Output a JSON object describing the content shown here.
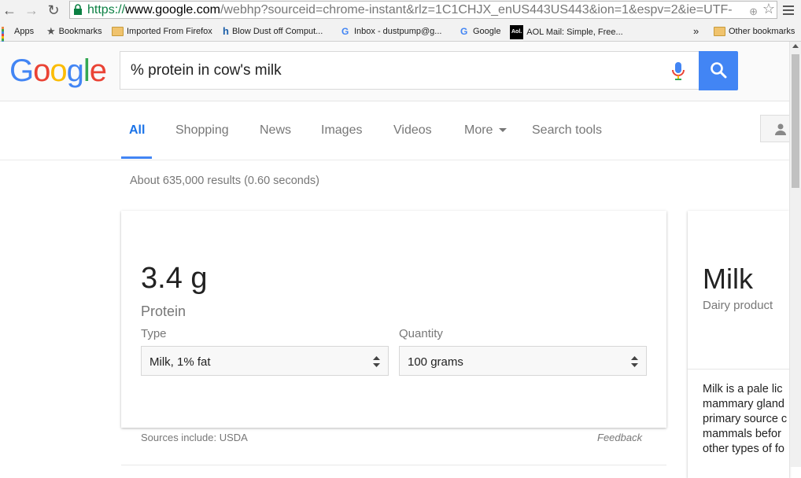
{
  "browser": {
    "url_scheme": "https://",
    "url_host": "www.google.com",
    "url_path": "/webhp?sourceid=chrome-instant&rlz=1C1CHJX_enUS443US443&ion=1&espv=2&ie=UTF-",
    "back_glyph": "←",
    "forward_glyph": "→",
    "reload_glyph": "↻",
    "star_glyph": "☆",
    "zoom_glyph": "⊕"
  },
  "bookmarks": {
    "items": [
      {
        "label": "Apps"
      },
      {
        "label": "Bookmarks"
      },
      {
        "label": "Imported From Firefox"
      },
      {
        "label": "Blow Dust off Comput..."
      },
      {
        "label": "Inbox - dustpump@g..."
      },
      {
        "label": "Google"
      },
      {
        "label": "AOL Mail: Simple, Free..."
      }
    ],
    "overflow": "»",
    "other": "Other bookmarks",
    "aol_badge": "Aol."
  },
  "google": {
    "logo": [
      "G",
      "o",
      "o",
      "g",
      "l",
      "e"
    ],
    "logo_colors": [
      "#4285f4",
      "#ea4335",
      "#fbbc05",
      "#4285f4",
      "#34a853",
      "#ea4335"
    ],
    "query": "% protein in cow's milk",
    "accent": "#4285f4"
  },
  "tabs": [
    {
      "label": "All"
    },
    {
      "label": "Shopping"
    },
    {
      "label": "News"
    },
    {
      "label": "Images"
    },
    {
      "label": "Videos"
    },
    {
      "label": "More"
    },
    {
      "label": "Search tools"
    }
  ],
  "results": {
    "stats": "About 635,000 results (0.60 seconds)"
  },
  "nutrition_card": {
    "amount": "3.4 g",
    "nutrient": "Protein",
    "type_label": "Type",
    "type_value": "Milk, 1% fat",
    "quantity_label": "Quantity",
    "quantity_value": "100 grams",
    "sources": "Sources include: USDA",
    "feedback": "Feedback"
  },
  "knowledge_panel": {
    "title": "Milk",
    "subtitle": "Dairy product",
    "description_lines": [
      "Milk is a pale lic",
      "mammary gland",
      "primary source c",
      "mammals befor",
      "other types of fo"
    ]
  }
}
